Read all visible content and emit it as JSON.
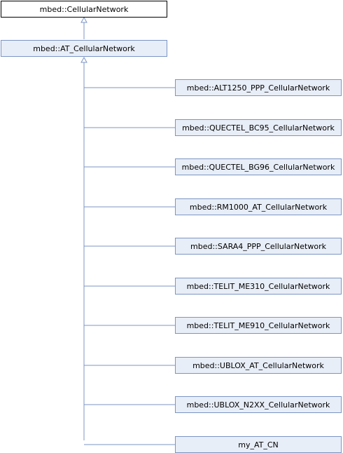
{
  "diagram": {
    "root": {
      "label": "mbed::CellularNetwork"
    },
    "base": {
      "label": "mbed::AT_CellularNetwork"
    },
    "derived": [
      {
        "label": "mbed::ALT1250_PPP_CellularNetwork"
      },
      {
        "label": "mbed::QUECTEL_BC95_CellularNetwork"
      },
      {
        "label": "mbed::QUECTEL_BG96_CellularNetwork"
      },
      {
        "label": "mbed::RM1000_AT_CellularNetwork"
      },
      {
        "label": "mbed::SARA4_PPP_CellularNetwork"
      },
      {
        "label": "mbed::TELIT_ME310_CellularNetwork"
      },
      {
        "label": "mbed::TELIT_ME910_CellularNetwork"
      },
      {
        "label": "mbed::UBLOX_AT_CellularNetwork"
      },
      {
        "label": "mbed::UBLOX_N2XX_CellularNetwork"
      },
      {
        "label": "my_AT_CN"
      }
    ],
    "colors": {
      "edge": "#7c95c4",
      "node_fill": "#e8eef7",
      "node_border": "#7c95c4",
      "root_border": "#000000"
    }
  }
}
